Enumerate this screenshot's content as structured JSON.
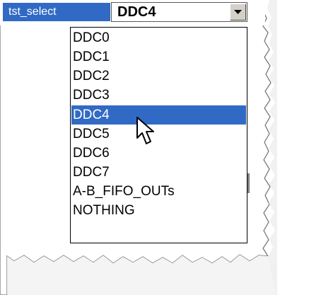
{
  "title": "",
  "top_bar": {
    "label": "tst_select",
    "selected_value": "DDC4",
    "dropdown_icon": "chevron-down-icon"
  },
  "dropdown": {
    "items": [
      "DDC0",
      "DDC1",
      "DDC2",
      "DDC3",
      "DDC4",
      "DDC5",
      "DDC6",
      "DDC7",
      "A-B_FIFO_OUTs",
      "NOTHING"
    ],
    "selected_index": 4
  },
  "colors": {
    "selection": "#316ac5",
    "selection_text": "#ffffff",
    "control_gray": "#d4d0c8"
  },
  "icons": {
    "cursor": "cursor-icon"
  }
}
